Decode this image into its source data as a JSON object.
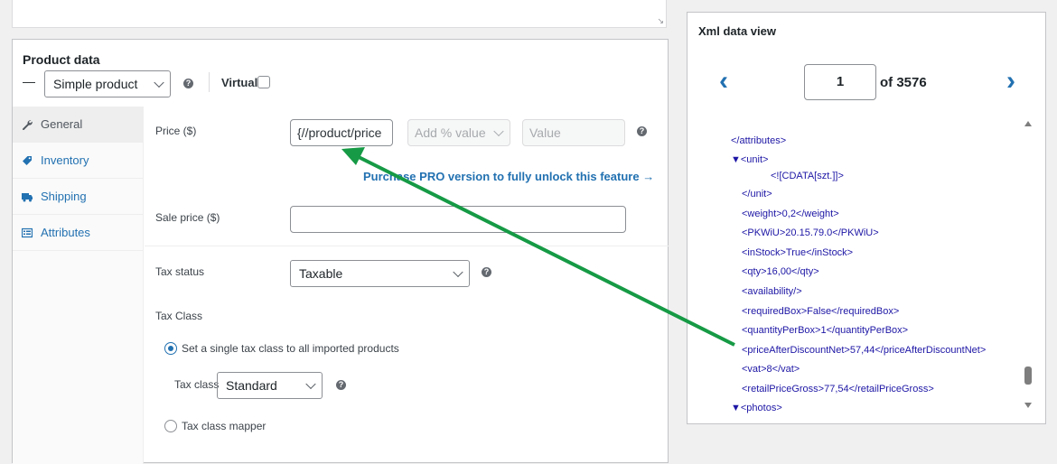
{
  "textarea_resize": "↘",
  "product_data": {
    "title": "Product data",
    "dash": "—",
    "type_select": "Simple product",
    "virtual_label": "Virtual",
    "help": "?"
  },
  "tabs": [
    {
      "label": "General",
      "icon": "wrench-icon"
    },
    {
      "label": "Inventory",
      "icon": "tag-icon"
    },
    {
      "label": "Shipping",
      "icon": "truck-icon"
    },
    {
      "label": "Attributes",
      "icon": "list-icon"
    }
  ],
  "general": {
    "price_label": "Price ($)",
    "price_value": "{//product/price",
    "add_pct": "Add % value",
    "value_placeholder": "Value",
    "pro_link": "Purchase PRO version to fully unlock this feature →",
    "sale_price_label": "Sale price ($)",
    "sale_price_value": "",
    "tax_status_label": "Tax status",
    "tax_status_value": "Taxable",
    "tax_class_heading": "Tax Class",
    "radio_single": "Set a single tax class to all imported products",
    "tax_class_label": "Tax class",
    "tax_class_value": "Standard",
    "radio_mapper": "Tax class mapper"
  },
  "xml_view": {
    "title": "Xml data view",
    "prev": "‹",
    "next": "›",
    "page": "1",
    "of": "of 3576",
    "lines": [
      "</attributes>",
      "▼<unit>",
      "<![CDATA[szt.]]>",
      "</unit>",
      "<weight>0,2</weight>",
      "<PKWiU>20.15.79.0</PKWiU>",
      "<inStock>True</inStock>",
      "<qty>16,00</qty>",
      "<availability/>",
      "<requiredBox>False</requiredBox>",
      "<quantityPerBox>1</quantityPerBox>",
      "<priceAfterDiscountNet>57,44</priceAfterDiscountNet>",
      "<vat>8</vat>",
      "<retailPriceGross>77,54</retailPriceGross>",
      "▼<photos>"
    ]
  },
  "colors": {
    "accent": "#2271b1",
    "arrow": "#169a45",
    "xml_tag": "#1d16a5",
    "xml_tag_end": "#a31515"
  }
}
